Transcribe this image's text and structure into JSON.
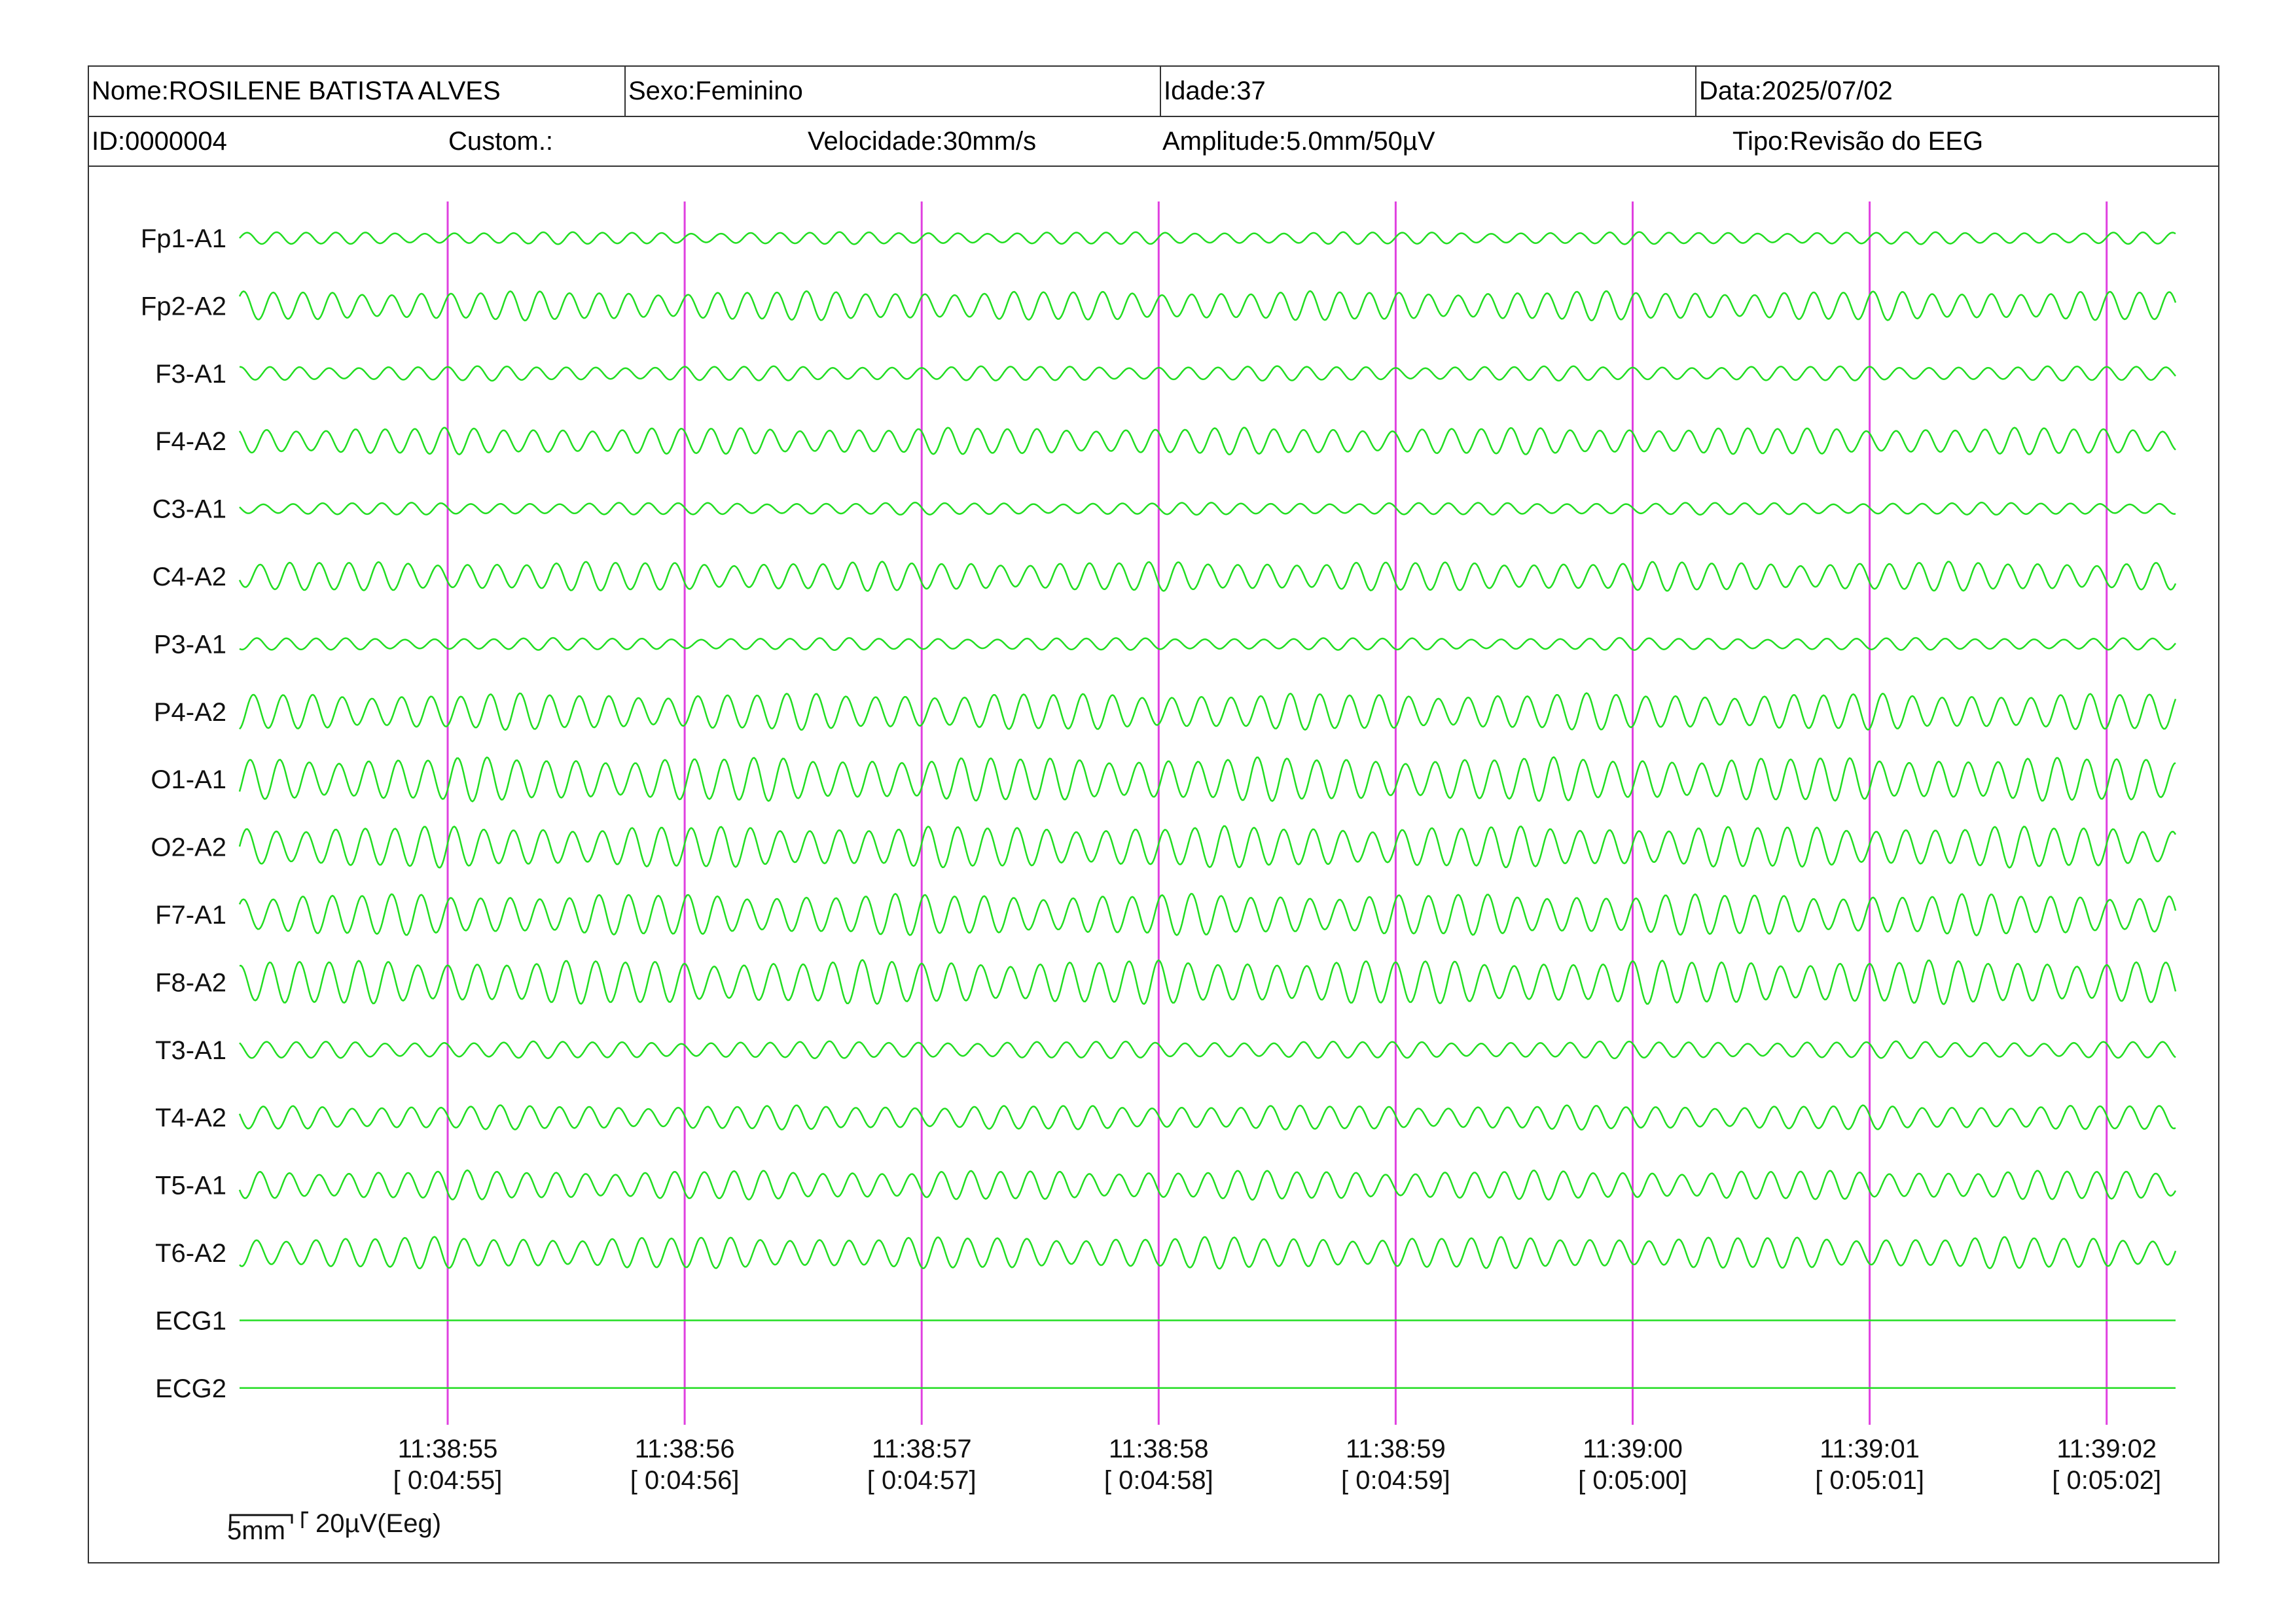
{
  "header": {
    "nome": "Nome:ROSILENE BATISTA ALVES",
    "sexo": "Sexo:Feminino",
    "idade": "Idade:37",
    "data": "Data:2025/07/02",
    "id": "ID:0000004",
    "custom": "Custom.:",
    "velocidade": "Velocidade:30mm/s",
    "amplitude": "Amplitude:5.0mm/50µV",
    "tipo": "Tipo:Revisão do EEG"
  },
  "chart_data": {
    "type": "line",
    "description_free": true,
    "channels": [
      {
        "name": "Fp1-A1",
        "amp": 0.25
      },
      {
        "name": "Fp2-A2",
        "amp": 0.6
      },
      {
        "name": "F3-A1",
        "amp": 0.3
      },
      {
        "name": "F4-A2",
        "amp": 0.55
      },
      {
        "name": "C3-A1",
        "amp": 0.25
      },
      {
        "name": "C4-A2",
        "amp": 0.6
      },
      {
        "name": "P3-A1",
        "amp": 0.25
      },
      {
        "name": "P4-A2",
        "amp": 0.75
      },
      {
        "name": "O1-A1",
        "amp": 0.9
      },
      {
        "name": "O2-A2",
        "amp": 0.85
      },
      {
        "name": "F7-A1",
        "amp": 0.85
      },
      {
        "name": "F8-A2",
        "amp": 0.9
      },
      {
        "name": "T3-A1",
        "amp": 0.35
      },
      {
        "name": "T4-A2",
        "amp": 0.5
      },
      {
        "name": "T5-A1",
        "amp": 0.6
      },
      {
        "name": "T6-A2",
        "amp": 0.65
      },
      {
        "name": "ECG1",
        "amp": 0
      },
      {
        "name": "ECG2",
        "amp": 0
      }
    ],
    "time_marks": [
      {
        "clock": "11:38:55",
        "elapsed": "[ 0:04:55]"
      },
      {
        "clock": "11:38:56",
        "elapsed": "[ 0:04:56]"
      },
      {
        "clock": "11:38:57",
        "elapsed": "[ 0:04:57]"
      },
      {
        "clock": "11:38:58",
        "elapsed": "[ 0:04:58]"
      },
      {
        "clock": "11:38:59",
        "elapsed": "[ 0:04:59]"
      },
      {
        "clock": "11:39:00",
        "elapsed": "[ 0:05:00]"
      },
      {
        "clock": "11:39:01",
        "elapsed": "[ 0:05:01]"
      },
      {
        "clock": "11:39:02",
        "elapsed": "[ 0:05:02]"
      }
    ],
    "cycles_per_second": 8,
    "trace_color": "#22dd22",
    "marker_color": "#e040e0"
  },
  "scale": {
    "time_label": "5mm",
    "amp_label": "20µV(Eeg)"
  }
}
